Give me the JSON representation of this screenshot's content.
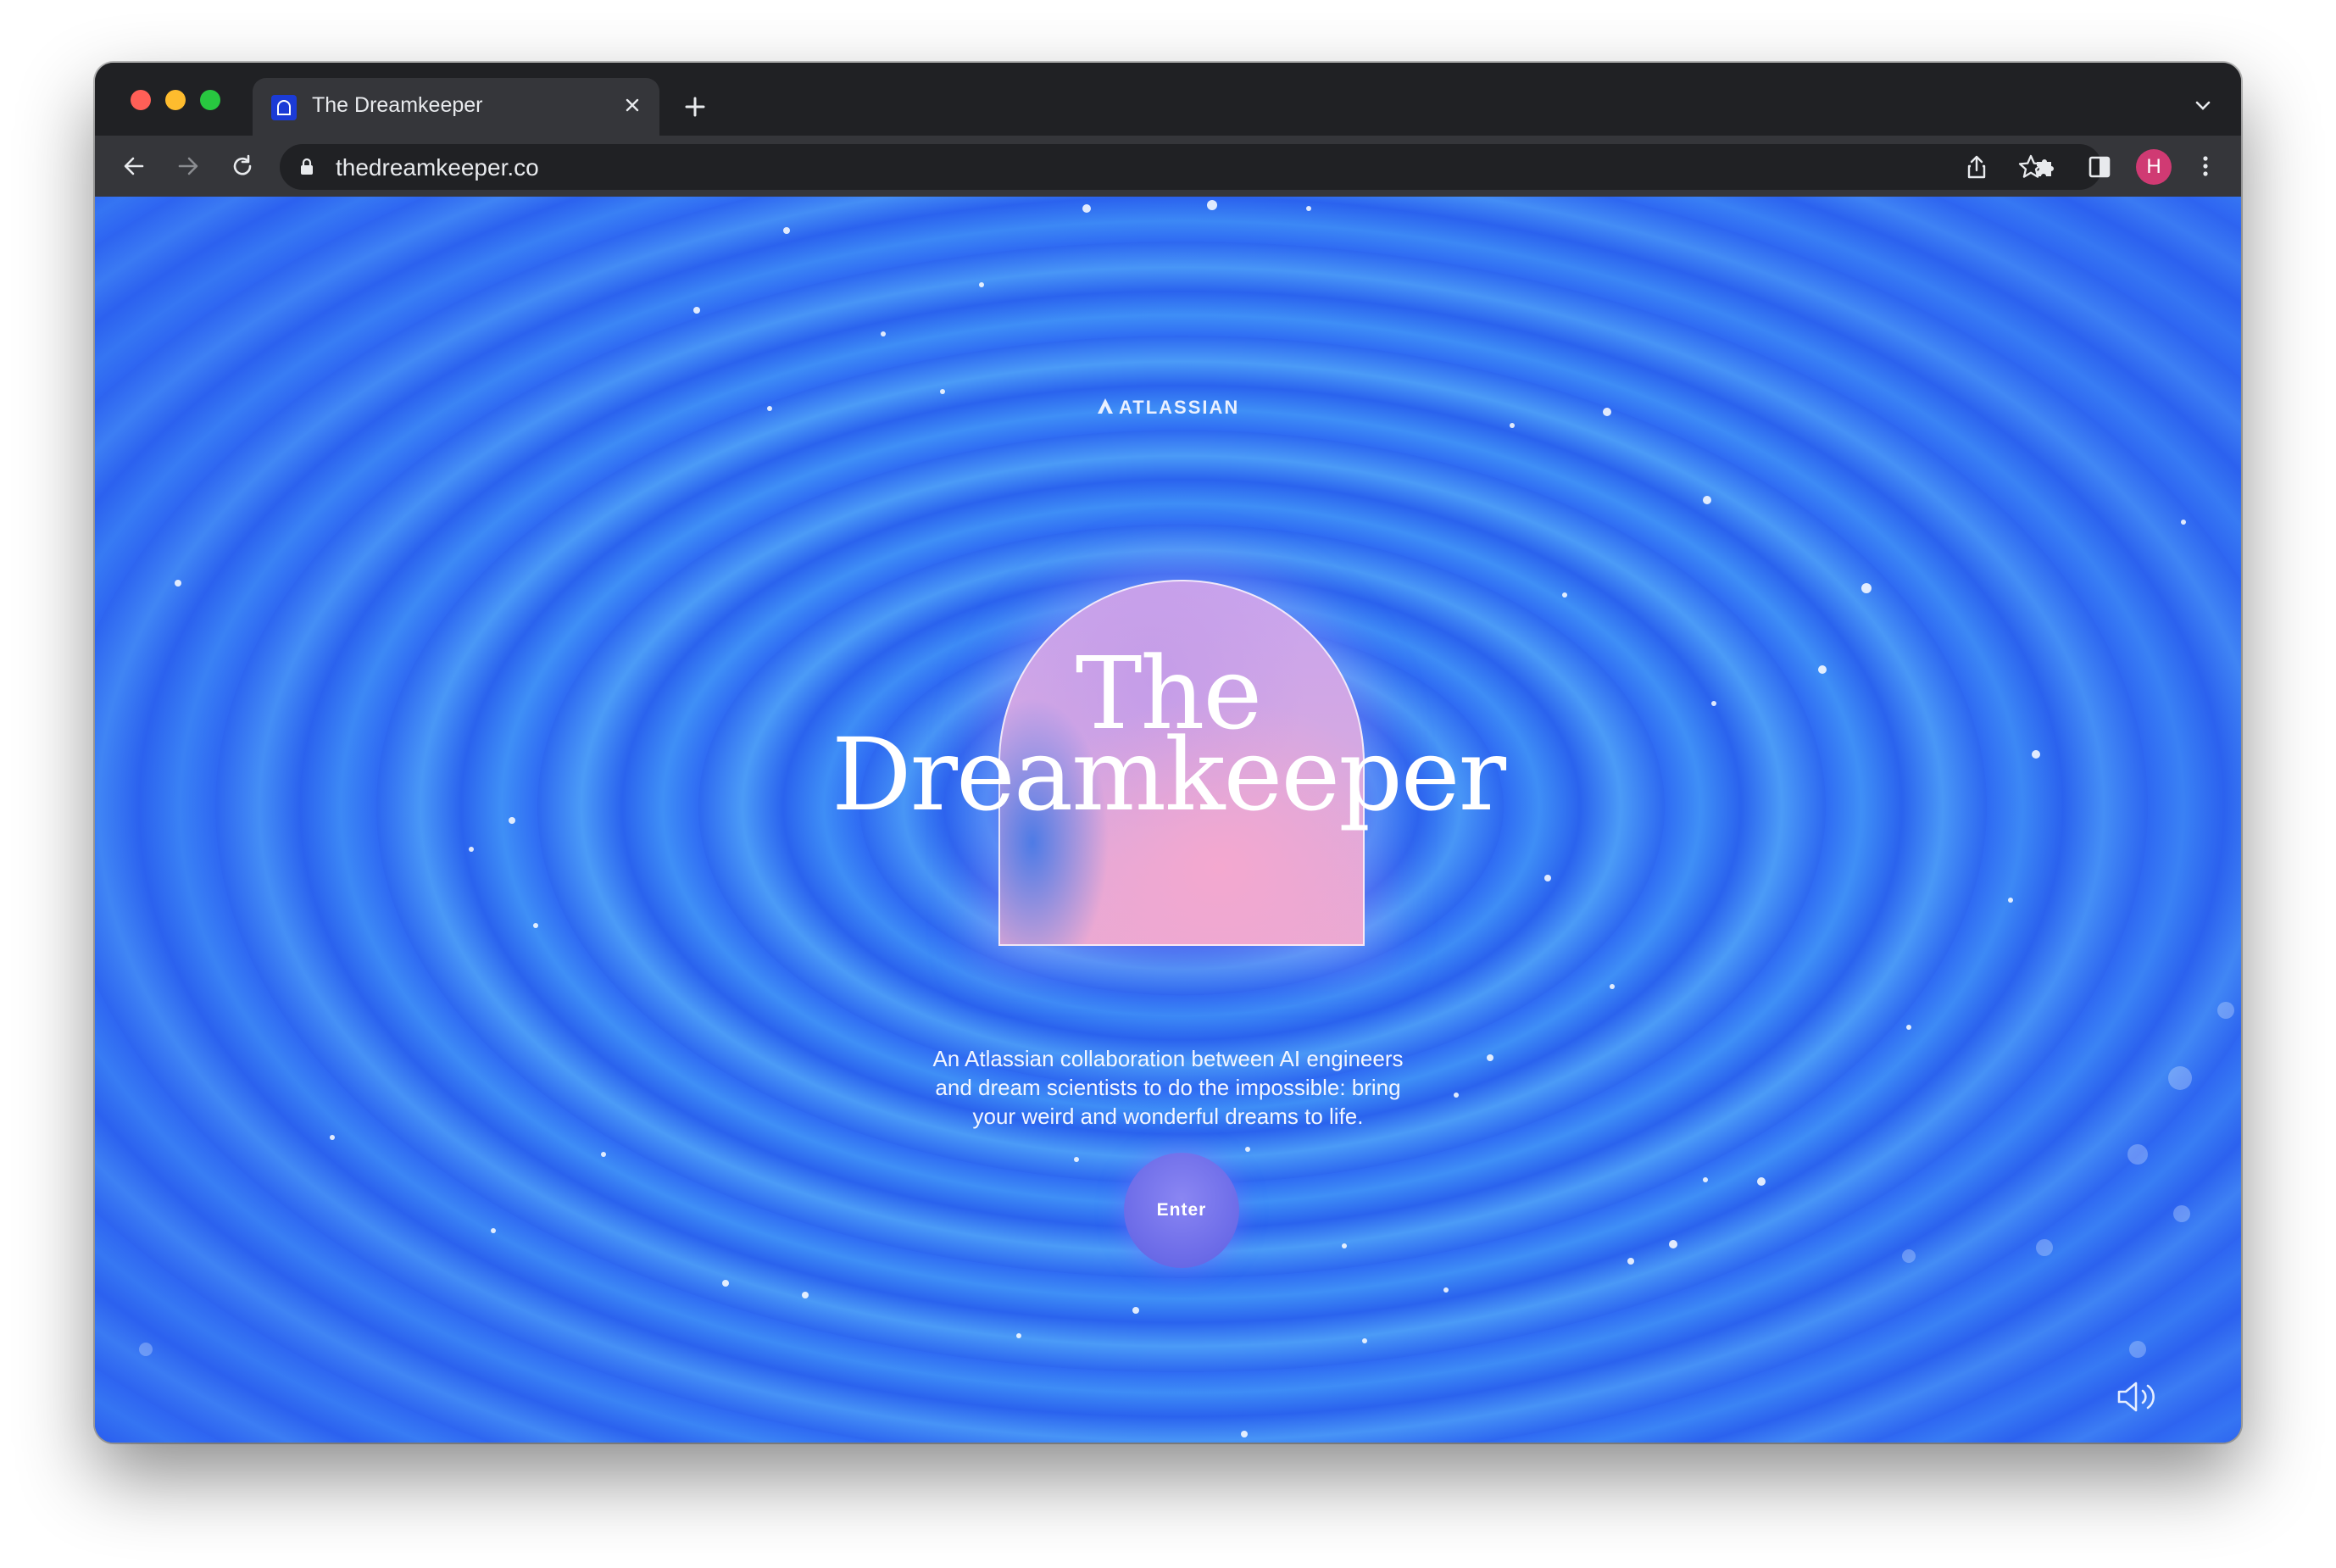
{
  "browser": {
    "tab": {
      "title": "The Dreamkeeper",
      "favicon": "dreamkeeper-arch-icon"
    },
    "address_bar": {
      "url": "thedreamkeeper.co"
    },
    "profile_initial": "H",
    "colors": {
      "frame": "#202124",
      "toolbar": "#35363a",
      "avatar": "#d03a73"
    }
  },
  "page": {
    "brand": "ATLASSIAN",
    "title_line_1": "The",
    "title_line_2": "Dreamkeeper",
    "tagline": "An Atlassian collaboration between AI engineers and dream scientists to do the impossible: bring your weird and wonderful dreams to life.",
    "enter_label": "Enter",
    "sound_icon": "speaker-icon",
    "colors": {
      "background": "#2f6cf3",
      "portal_pink": "#f4a8cf",
      "portal_lilac": "#c8a4ee",
      "enter_button": "#6f6ee9"
    }
  }
}
